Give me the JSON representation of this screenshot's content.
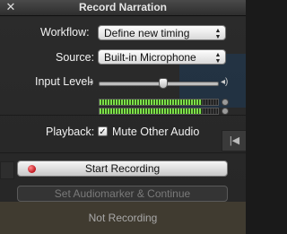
{
  "window": {
    "title": "Record Narration"
  },
  "workflow": {
    "label": "Workflow:",
    "value": "Define new timing"
  },
  "source": {
    "label": "Source:",
    "value": "Built-in Microphone"
  },
  "input_level": {
    "label": "Input Level:",
    "level": 0.54,
    "meter_left": 0.86,
    "meter_right": 0.86
  },
  "playback": {
    "label": "Playback:",
    "checkbox_label": "Mute Other Audio",
    "checked": true
  },
  "buttons": {
    "start_recording": "Start Recording",
    "set_audiomarker": "Set Audiomarker & Continue"
  },
  "status": {
    "text": "Not Recording"
  },
  "icons": {
    "close": "close-icon",
    "record": "record-dot-icon",
    "popup_arrows": "updown-arrows-icon",
    "volume_low": "volume-low-icon",
    "volume_high": "volume-high-icon"
  },
  "colors": {
    "record_red": "#c0141d",
    "meter_green": "#7ee04a"
  }
}
